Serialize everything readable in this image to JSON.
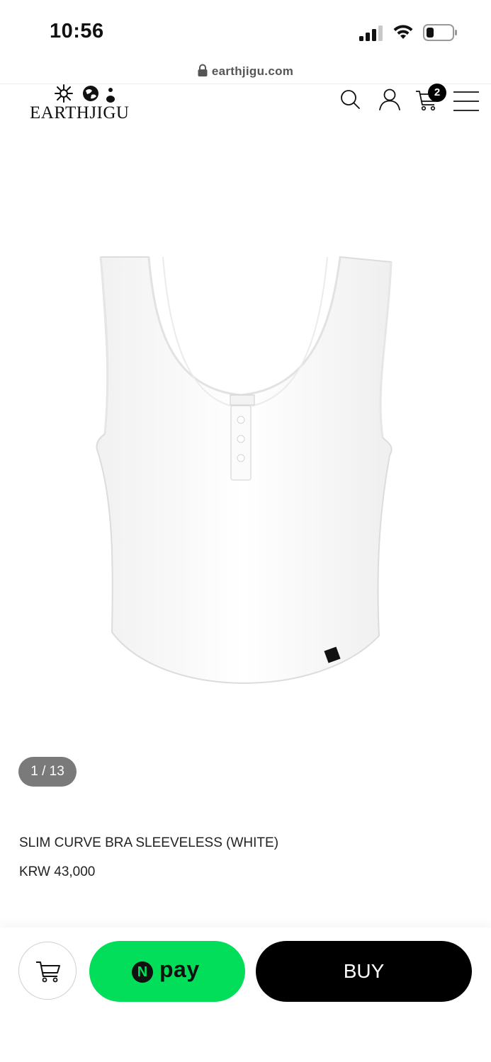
{
  "status_bar": {
    "time": "10:56"
  },
  "browser": {
    "url": "earthjigu.com"
  },
  "header": {
    "logo_text": "EARTHJIGU",
    "cart_count": "2",
    "icons": [
      "search-icon",
      "user-icon",
      "cart-icon",
      "menu-icon"
    ]
  },
  "product": {
    "image_pager": "1 / 13",
    "name": "SLIM CURVE BRA SLEEVELESS (WHITE)",
    "price": "KRW 43,000"
  },
  "actions": {
    "npay_n": "N",
    "npay_label": "pay",
    "buy_label": "BUY"
  },
  "colors": {
    "npay_green": "#03de5a",
    "buy_black": "#000000",
    "pager_gray": "#7a7a7a"
  }
}
